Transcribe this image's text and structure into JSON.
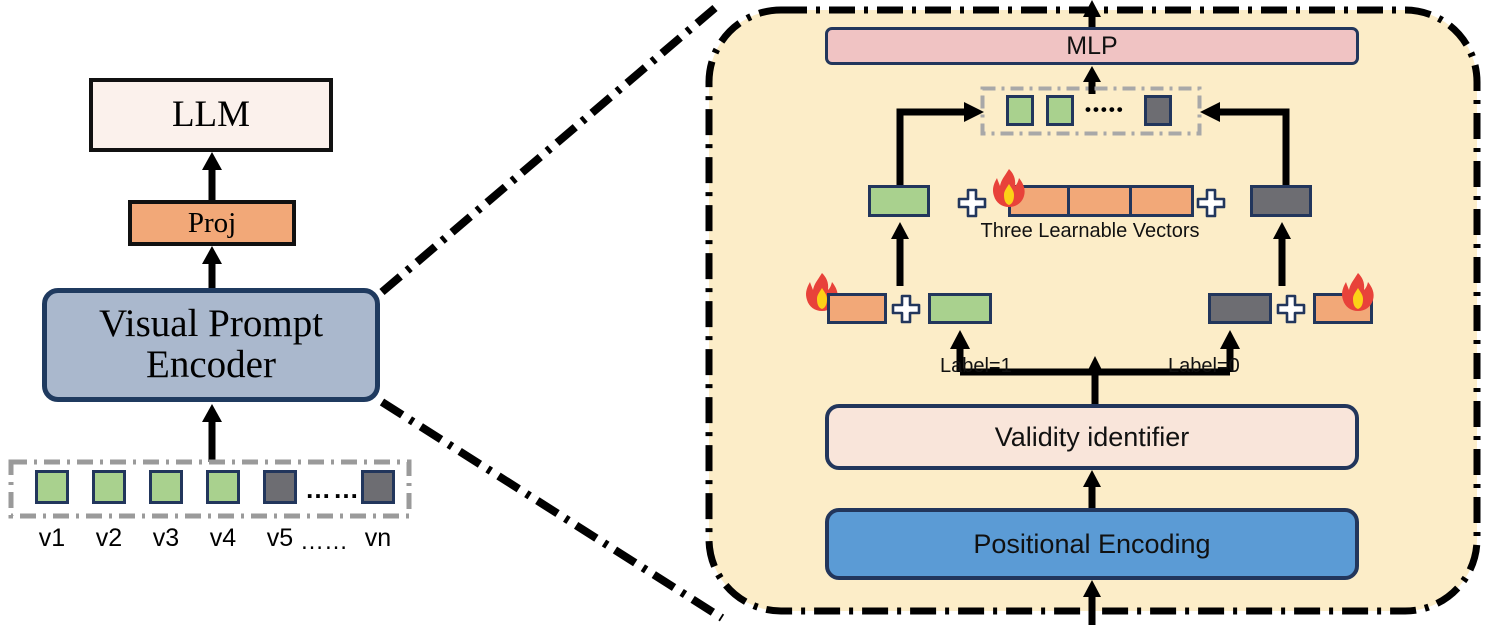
{
  "left_panel": {
    "llm": {
      "label": "LLM"
    },
    "proj": {
      "label": "Proj"
    },
    "encoder": {
      "label_line1": "Visual  Prompt",
      "label_line2": "Encoder"
    },
    "tokens": [
      {
        "id": "v1",
        "label": "v1",
        "type": "valid",
        "color": "#a9d18e"
      },
      {
        "id": "v2",
        "label": "v2",
        "type": "valid",
        "color": "#a9d18e"
      },
      {
        "id": "v3",
        "label": "v3",
        "type": "valid",
        "color": "#a9d18e"
      },
      {
        "id": "v4",
        "label": "v4",
        "type": "valid",
        "color": "#a9d18e"
      },
      {
        "id": "v5",
        "label": "v5",
        "type": "invalid",
        "color": "#6d6d72"
      },
      {
        "id": "vn",
        "label": "vn",
        "type": "invalid",
        "color": "#6d6d72"
      }
    ],
    "token_ellipsis": "……",
    "token_ellipsis_label": "……"
  },
  "right_panel": {
    "mlp": {
      "label": "MLP"
    },
    "output_tokens": {
      "items": [
        {
          "color": "#a9d18e"
        },
        {
          "color": "#a9d18e"
        },
        {
          "color": "#6d6d72"
        }
      ],
      "ellipsis": "•••••"
    },
    "learnable_vectors": {
      "caption": "Three Learnable Vectors",
      "cells": 3,
      "color": "#f2a878",
      "fire_icon": "fire-icon"
    },
    "left_branch": {
      "label": "Label=1",
      "sum_bar_color": "#a9d18e",
      "learnable_bar_color": "#f2a878",
      "plus": "+"
    },
    "right_branch": {
      "label": "Label=0",
      "sum_bar_color": "#6d6d72",
      "learnable_bar_color": "#f2a878",
      "plus": "+"
    },
    "validity_identifier": {
      "label": "Validity identifier"
    },
    "positional_encoding": {
      "label": "Positional Encoding"
    }
  },
  "colors": {
    "panel_bg": "#fcedc8",
    "mlp_bg": "#f0c3c3",
    "validity_bg": "#f9e5da",
    "positional_bg": "#5b9bd5",
    "encoder_bg": "#aab8cd",
    "proj_bg": "#f2a878",
    "llm_bg": "#fbf1ec",
    "valid_token": "#a9d18e",
    "invalid_token": "#6d6d72",
    "border_navy": "#22365c",
    "dashed_gray": "#9a9a9a"
  }
}
